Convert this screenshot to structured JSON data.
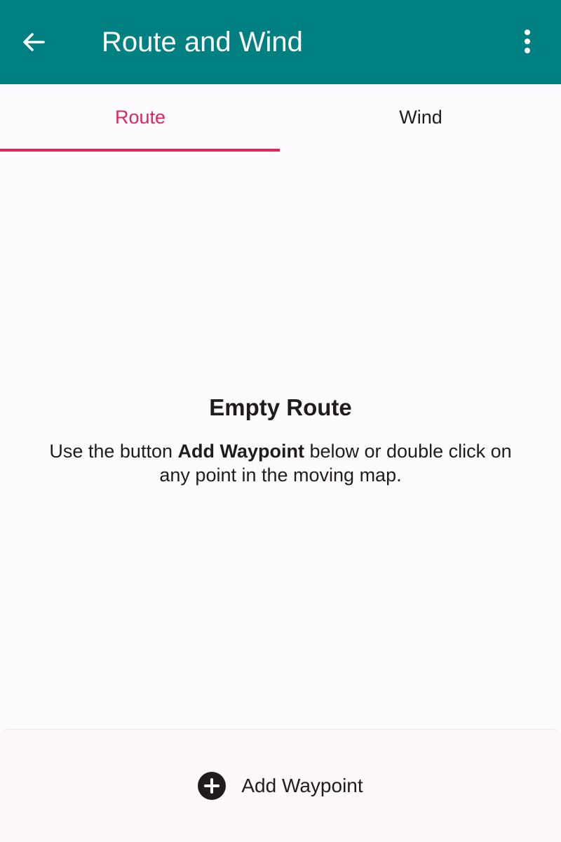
{
  "header": {
    "title": "Route and Wind",
    "back_icon": "arrow-back-icon",
    "menu_icon": "more-vert-icon",
    "background_color": "#008080"
  },
  "tabs": [
    {
      "label": "Route",
      "active": true
    },
    {
      "label": "Wind",
      "active": false
    }
  ],
  "accent_color": "#e0245e",
  "empty_state": {
    "title": "Empty Route",
    "text_before": "Use the button ",
    "text_bold": "Add Waypoint",
    "text_after": " below or double click on any point in the moving map."
  },
  "bottom_bar": {
    "add_button_label": "Add Waypoint",
    "add_icon": "add-circle-icon"
  }
}
